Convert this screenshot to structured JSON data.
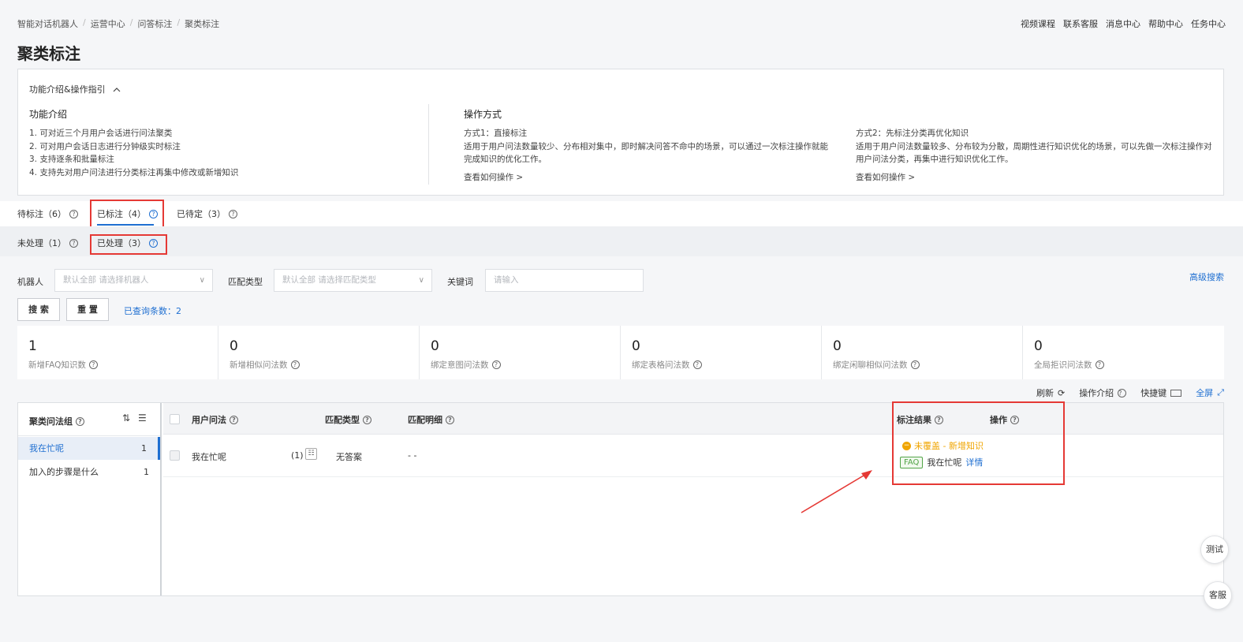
{
  "breadcrumb": [
    "智能对话机器人",
    "运营中心",
    "问答标注",
    "聚类标注"
  ],
  "top_links": [
    "视频课程",
    "联系客服",
    "消息中心",
    "帮助中心",
    "任务中心"
  ],
  "page_title": "聚类标注",
  "intro": {
    "toggle_label": "功能介绍&操作指引",
    "left_title": "功能介绍",
    "left_items": [
      "1. 可对近三个月用户会话进行问法聚类",
      "2. 可对用户会话日志进行分钟级实时标注",
      "3. 支持逐条和批量标注",
      "4. 支持先对用户问法进行分类标注再集中修改或新增知识"
    ],
    "ops_title": "操作方式",
    "method1_title": "方式1：直接标注",
    "method1_text": "适用于用户问法数量较少、分布相对集中，即时解决问答不命中的场景，可以通过一次标注操作就能完成知识的优化工作。",
    "method1_link": "查看如何操作 >",
    "method2_title": "方式2：先标注分类再优化知识",
    "method2_text": "适用于用户问法数量较多、分布较为分散，周期性进行知识优化的场景，可以先做一次标注操作对用户问法分类，再集中进行知识优化工作。",
    "method2_link": "查看如何操作 >"
  },
  "tabs": [
    {
      "label": "待标注（6）"
    },
    {
      "label": "已标注（4）"
    },
    {
      "label": "已待定（3）"
    }
  ],
  "subtabs": [
    {
      "label": "未处理（1）"
    },
    {
      "label": "已处理（3）"
    }
  ],
  "filters": {
    "robot_label": "机器人",
    "robot_placeholder": "默认全部 请选择机器人",
    "match_label": "匹配类型",
    "match_placeholder": "默认全部 请选择匹配类型",
    "keyword_label": "关键词",
    "keyword_placeholder": "请输入",
    "advanced": "高级搜索"
  },
  "buttons": {
    "search": "搜 索",
    "reset": "重 置",
    "result_count": "已查询条数：2"
  },
  "stats": [
    {
      "value": "1",
      "label": "新增FAQ知识数"
    },
    {
      "value": "0",
      "label": "新增相似问法数"
    },
    {
      "value": "0",
      "label": "绑定意图问法数"
    },
    {
      "value": "0",
      "label": "绑定表格问法数"
    },
    {
      "value": "0",
      "label": "绑定闲聊相似问法数"
    },
    {
      "value": "0",
      "label": "全局拒识问法数"
    }
  ],
  "toolbar": {
    "refresh": "刷新",
    "guide": "操作介绍",
    "shortcut": "快捷键",
    "fullscreen": "全屏"
  },
  "cluster": {
    "title": "聚类问法组",
    "items": [
      {
        "label": "我在忙呢",
        "count": "1"
      },
      {
        "label": "加入的步骤是什么",
        "count": "1"
      }
    ]
  },
  "table": {
    "headers": {
      "question": "用户问法",
      "match_type": "匹配类型",
      "match_detail": "匹配明细",
      "result": "标注结果",
      "action": "操作"
    },
    "rows": [
      {
        "question": "我在忙呢",
        "count": "(1)",
        "match_type": "无答案",
        "match_detail": "- -",
        "status": "未覆盖 - 新增知识",
        "tag": "FAQ",
        "answer": "我在忙呢",
        "detail_link": "详情"
      }
    ]
  },
  "float": {
    "test": "测试",
    "service": "客服"
  },
  "colors": {
    "accent": "#1f6fd1",
    "highlight": "#e53935",
    "warning": "#f0a500",
    "faq_tag": "#52a447"
  }
}
